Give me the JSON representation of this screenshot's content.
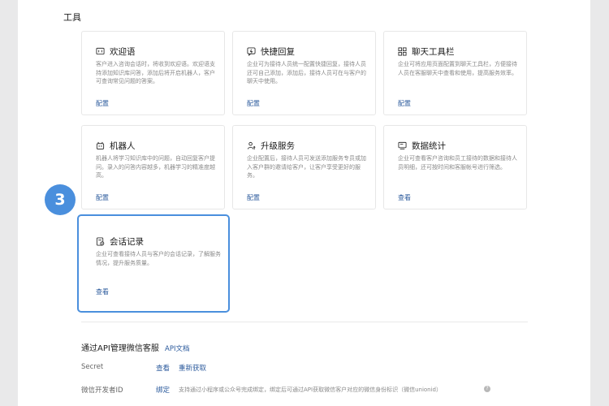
{
  "tools": {
    "section_title": "工具",
    "cards": [
      {
        "title": "欢迎语",
        "desc": "客户进入咨询会话时，将收到欢迎语。欢迎语支持添加知识库问答，添加后将开启机器人，客户可查询常见问题的答案。",
        "action": "配置",
        "icon": "chat-bubble-icon"
      },
      {
        "title": "快捷回复",
        "desc": "企业可为接待人员统一配置快捷回复，接待人员还可自己添加，添加后，接待人员可在与客户的聊天中使用。",
        "action": "配置",
        "icon": "quick-reply-icon"
      },
      {
        "title": "聊天工具栏",
        "desc": "企业可将应用页面配置到聊天工具栏，方便接待人员在客服聊天中查看和使用，提高服务效率。",
        "action": "配置",
        "icon": "grid-icon"
      },
      {
        "title": "机器人",
        "desc": "机器人将学习知识库中的问题，自动回复客户提问。录入的问答内容越多，机器学习的精准度越高。",
        "action": "配置",
        "icon": "robot-icon"
      },
      {
        "title": "升级服务",
        "desc": "企业配置后，接待人员可发送添加服务专员或加入客户群的邀请给客户，让客户享受更好的服务。",
        "action": "配置",
        "icon": "upgrade-icon"
      },
      {
        "title": "数据统计",
        "desc": "企业可查看客户咨询和员工接待的数据和接待人员明细，还可按时间和客服帐号进行筛选。",
        "action": "查看",
        "icon": "monitor-icon"
      },
      {
        "title": "会话记录",
        "desc": "企业可查看接待人员与客户的会话记录，了解服务情况，提升服务质量。",
        "action": "查看",
        "icon": "record-icon"
      }
    ]
  },
  "step_badge": "3",
  "api": {
    "title": "通过API管理微信客服",
    "doc_link": "API文档",
    "secret_label": "Secret",
    "secret_view": "查看",
    "secret_refresh": "重新获取",
    "dev_id_label": "微信开发者ID",
    "dev_id_bind": "绑定",
    "dev_id_note": "支持通过小程序或公众号完成绑定，绑定后可通过API获取微信客户对应的微信身份标识（微信unionid）"
  },
  "colors": {
    "accent": "#4a8fdd",
    "link": "#2b5a9c"
  }
}
